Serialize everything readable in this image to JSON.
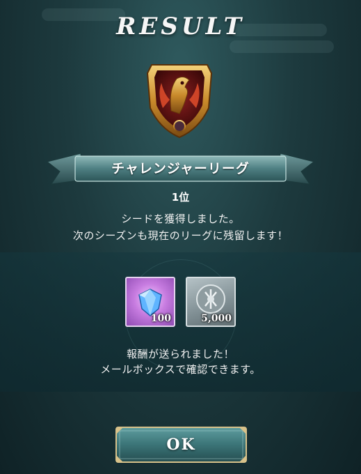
{
  "header": {
    "title": "RESULT"
  },
  "league": {
    "name": "チャレンジャーリーグ",
    "rank": "1位",
    "emblem_icon": "phoenix-emblem-icon"
  },
  "messages": {
    "line1": "シードを獲得しました。",
    "line2": "次のシーズンも現在のリーグに残留します！"
  },
  "rewards": {
    "items": [
      {
        "icon": "diamond-gem-icon",
        "count": "100"
      },
      {
        "icon": "silver-medal-icon",
        "count": "5,000"
      }
    ],
    "line1": "報酬が送られました！",
    "line2": "メールボックスで確認できます。"
  },
  "actions": {
    "ok_label": "OK"
  },
  "colors": {
    "accent_teal": "#3f7f82",
    "gold": "#d9a43b"
  }
}
